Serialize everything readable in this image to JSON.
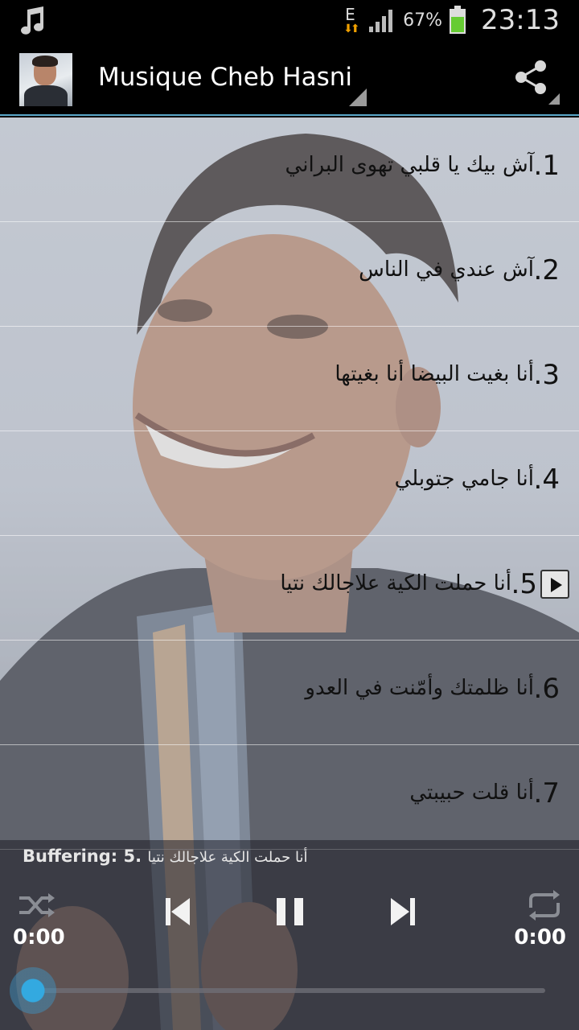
{
  "status_bar": {
    "network_type": "E",
    "battery_percent": "67%",
    "time": "23:13",
    "icons": [
      "music-note-icon",
      "data-arrows-icon",
      "signal-icon",
      "battery-icon"
    ]
  },
  "action_bar": {
    "title": "Musique Cheb Hasni",
    "share_icon": "share-icon"
  },
  "songs": [
    {
      "number": ".1",
      "title": "آش بيك يا قلبي تهوى البراني"
    },
    {
      "number": ".2",
      "title": "آش عندي في الناس"
    },
    {
      "number": ".3",
      "title": "أنا بغيت البيضا أنا بغيتها"
    },
    {
      "number": ".4",
      "title": "أنا جامي جتوبلي"
    },
    {
      "number": ".5",
      "title": "أنا حملت الكية علاجالك نتيا",
      "playing": true
    },
    {
      "number": ".6",
      "title": "أنا ظلمتك وأمّنت في العدو"
    },
    {
      "number": ".7",
      "title": "أنا قلت حبيبتي"
    }
  ],
  "player": {
    "status_label": "Buffering: 5.",
    "current_song": "أنا حملت الكية علاجالك نتيا",
    "time_elapsed": "0:00",
    "time_total": "0:00",
    "progress": 0,
    "controls": [
      "shuffle-icon",
      "previous-icon",
      "pause-icon",
      "next-icon",
      "repeat-icon"
    ]
  },
  "colors": {
    "accent": "#5aa7c8",
    "seek_thumb": "#33a9e0",
    "status_bar_bg": "#000000",
    "battery_green": "#66cc33"
  }
}
